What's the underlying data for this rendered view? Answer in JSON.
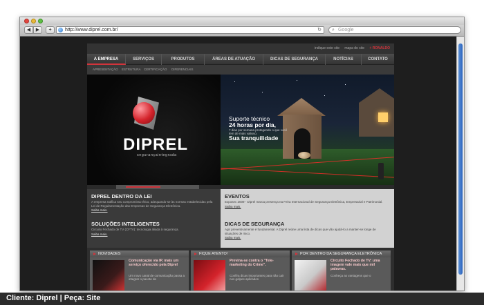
{
  "browser": {
    "url": "http://www.diprel.com.br/",
    "search_placeholder": "Google",
    "back_label": "◀",
    "forward_label": "▶",
    "add_label": "+",
    "reload_label": "↻"
  },
  "site": {
    "top_links": {
      "indique": "indique este site",
      "mapa": "mapa do site",
      "highlight": "+ RONALDO"
    },
    "nav": [
      "A EMPRESA",
      "SERVIÇOS",
      "PRODUTOS",
      "ÁREAS DE ATUAÇÃO",
      "DICAS DE SEGURANÇA",
      "NOTÍCIAS",
      "CONTATO"
    ],
    "subnav": [
      "APRESENTAÇÃO",
      "ESTRUTURA",
      "CERTIFICAÇÃO",
      "DIFERENCIAIS"
    ],
    "brand": "DIPREL",
    "tagline": "segurançaintegrada",
    "hero": {
      "line1": "Suporte técnico",
      "line2": "24 horas por dia,",
      "line3": "7 dias por semana protegendo o que você tem de mais valioso.",
      "line4": "Sua tranquilidade"
    },
    "info": {
      "lei_title": "DIPREL DENTRO DA LEI",
      "lei_body": "A empresa ratifica seu compromisso ético, adequando-se às normas estabelecidas pela Lei de Regulamentação das Empresas de Segurança Eletrônica.",
      "solucoes_title": "SOLUÇÕES INTELIGENTES",
      "solucoes_body": "Circuito Fechado de TV (CFTV): tecnologia aliada à segurança.",
      "eventos_title": "EVENTOS",
      "eventos_body": "Exposec 2009 - Diprel marca presença na Feira Internacional de Segurança Eletrônica, Empresarial e Patrimonial.",
      "dicas_title": "DICAS DE SEGURANÇA",
      "dicas_body": "Agir preventivamente é fundamental. A Diprel reúne uma lista de dicas que vão ajudá-lo a manter-se longe de situações de risco.",
      "more": "Saiba mais."
    },
    "panels": [
      {
        "header": "NOVIDADES",
        "title": "Comunicação via IP, mais um serviço oferecido pela Diprel",
        "text": "Um novo canal de comunicação passa a integrar o pacote de"
      },
      {
        "header": "FIQUE ATENTO!",
        "title": "Previna-se contra o \"Tele-marketing do Crime\".",
        "text": "Confira dicas importantes para não cair nos golpes aplicados"
      },
      {
        "header": "POR DENTRO DA SEGURANÇA ELETRÔNICA",
        "title": "Circuito Fechado de TV: uma imagem vale mais que mil palavras.",
        "text": "Conheça as vantagens que o"
      }
    ]
  },
  "caption": "Cliente: Diprel | Peça: Site",
  "colors": {
    "accent": "#d2343b",
    "page": "#1e1e1e",
    "caption_bar": "#2b2b2b"
  }
}
